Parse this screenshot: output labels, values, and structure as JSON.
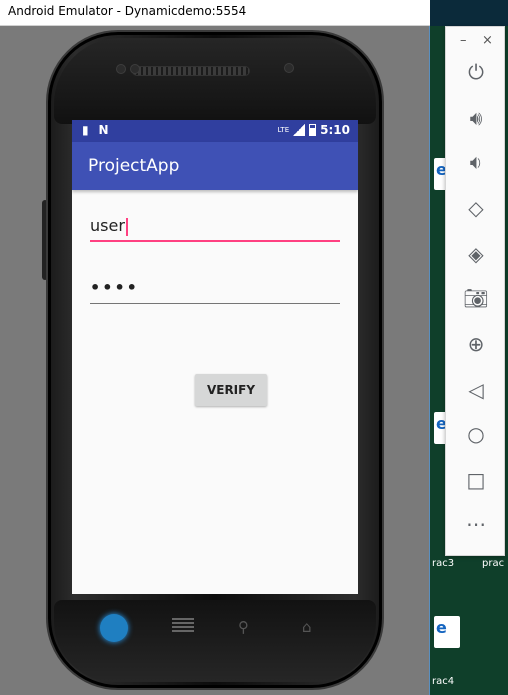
{
  "window": {
    "title": "Android Emulator - Dynamicdemo:5554"
  },
  "statusbar": {
    "time": "5:10",
    "network": "LTE",
    "left_icons": [
      "sd-card-icon",
      "n-notification-icon"
    ]
  },
  "app": {
    "title": "ProjectApp"
  },
  "form": {
    "username_value": "user",
    "password_value": "••••",
    "verify_label": "VERIFY"
  },
  "colors": {
    "statusbar": "#303f9f",
    "appbar": "#3f51b5",
    "accent": "#ff4081",
    "button": "#d6d7d7"
  },
  "control_panel": {
    "buttons": [
      "power-icon",
      "volume-up-icon",
      "volume-down-icon",
      "rotate-left-icon",
      "rotate-right-icon",
      "camera-icon",
      "zoom-icon",
      "back-icon",
      "home-icon",
      "overview-icon",
      "more-icon"
    ]
  },
  "desktop": {
    "labels": [
      "rac3",
      "prac",
      "rac4"
    ]
  }
}
